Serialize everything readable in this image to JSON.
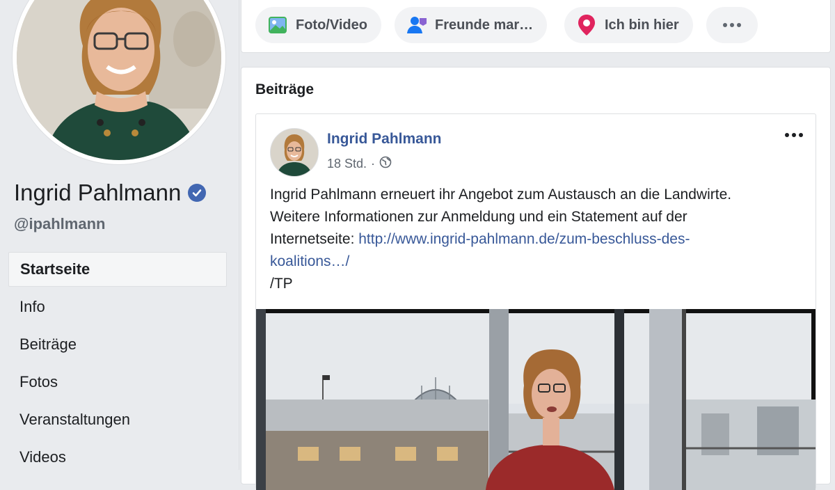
{
  "profile": {
    "name": "Ingrid Pahlmann",
    "handle": "@ipahlmann"
  },
  "sidebar": {
    "items": [
      {
        "label": "Startseite",
        "active": true
      },
      {
        "label": "Info"
      },
      {
        "label": "Beiträge"
      },
      {
        "label": "Fotos"
      },
      {
        "label": "Veranstaltungen"
      },
      {
        "label": "Videos"
      }
    ]
  },
  "composer": {
    "photo_label": "Foto/Video",
    "tag_label": "Freunde mar…",
    "checkin_label": "Ich bin hier"
  },
  "posts": {
    "title": "Beiträge",
    "post": {
      "author": "Ingrid Pahlmann",
      "time": "18 Std.",
      "separator": "·",
      "text_line1": "Ingrid Pahlmann erneuert ihr Angebot zum Austausch an die Landwirte.",
      "text_line2": "Weitere Informationen zur Anmeldung und ein Statement auf der",
      "text_line3_prefix": "Internetseite: ",
      "link_part1": "http://www.ingrid-pahlmann.de/zum-beschluss-des-",
      "link_part2": "koalitions…/",
      "signature": "/TP"
    }
  },
  "colors": {
    "page_bg": "#e9ebee",
    "link": "#385898",
    "verified": "#4267b2",
    "location_pin": "#e0245e"
  },
  "icons": [
    "verified-badge-icon",
    "photo-video-icon",
    "tag-friends-icon",
    "location-pin-icon",
    "more-icon",
    "globe-icon"
  ]
}
